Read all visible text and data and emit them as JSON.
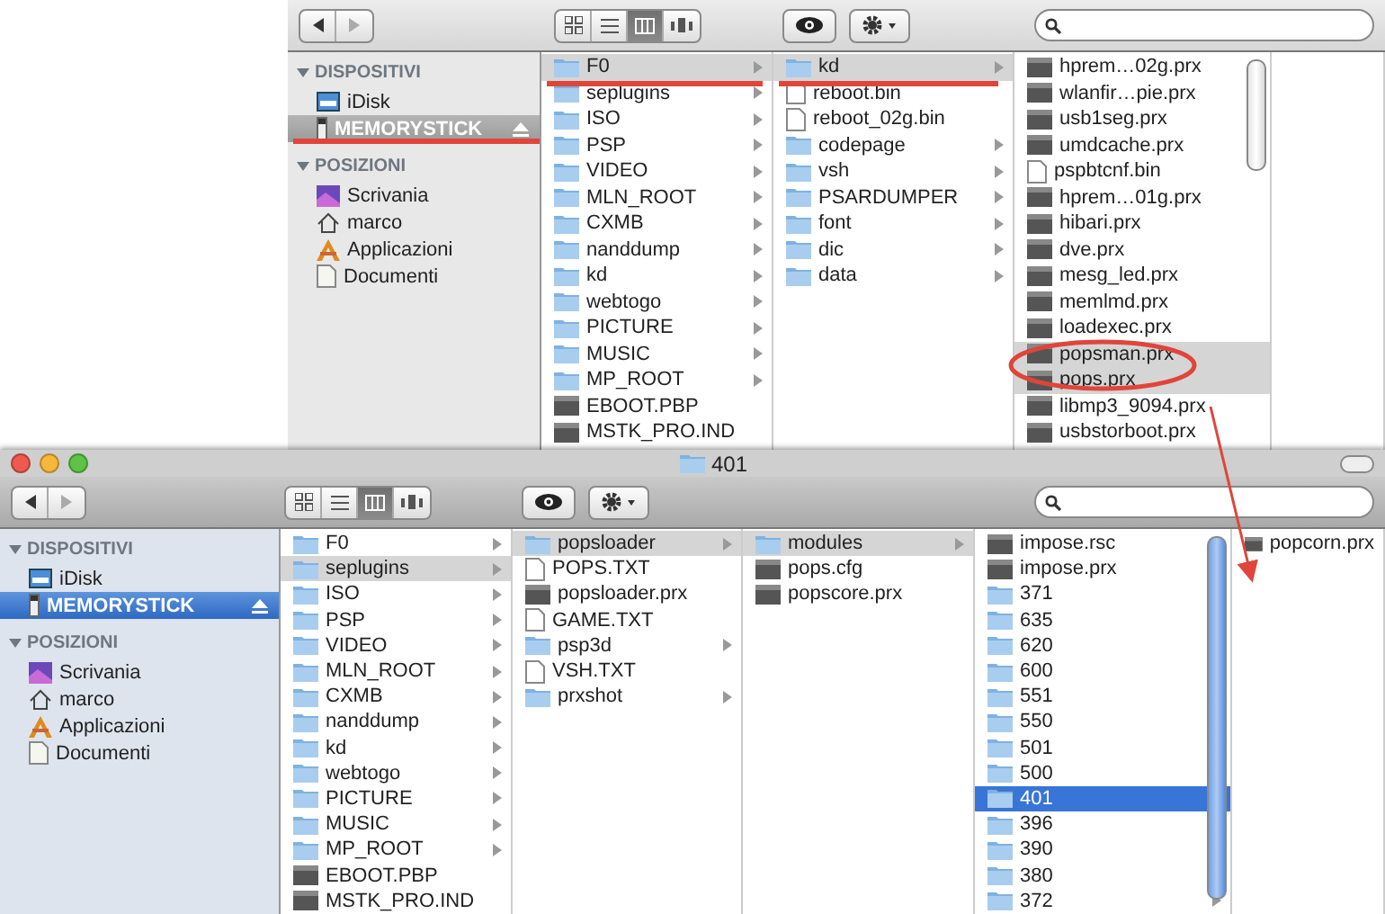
{
  "windows": [
    {
      "active": false,
      "nav": [
        {
          "kind": "back",
          "disabled": false
        },
        {
          "kind": "forward",
          "disabled": true
        }
      ],
      "views": [
        {
          "kind": "icons",
          "selected": false
        },
        {
          "kind": "list",
          "selected": false
        },
        {
          "kind": "columns",
          "selected": true
        },
        {
          "kind": "coverflow",
          "selected": false
        }
      ],
      "sidebar": [
        {
          "title": "DISPOSITIVI",
          "expanded": true,
          "items": [
            {
              "label": "iDisk",
              "kind": "disk",
              "selected": false,
              "eject": false
            },
            {
              "label": "MEMORYSTICK",
              "kind": "drive",
              "selected": true,
              "eject": true
            }
          ]
        },
        {
          "title": "POSIZIONI",
          "expanded": true,
          "items": [
            {
              "label": "Scrivania",
              "kind": "desktop",
              "selected": false,
              "eject": false
            },
            {
              "label": "marco",
              "kind": "home",
              "selected": false,
              "eject": false
            },
            {
              "label": "Applicazioni",
              "kind": "apps",
              "selected": false,
              "eject": false
            },
            {
              "label": "Documenti",
              "kind": "documents",
              "selected": false,
              "eject": false
            }
          ]
        }
      ],
      "columns": [
        {
          "focused": false,
          "items": [
            {
              "name": "F0",
              "kind": "folder",
              "selected": true
            },
            {
              "name": "seplugins",
              "kind": "folder",
              "selected": false
            },
            {
              "name": "ISO",
              "kind": "folder",
              "selected": false
            },
            {
              "name": "PSP",
              "kind": "folder",
              "selected": false
            },
            {
              "name": "VIDEO",
              "kind": "folder",
              "selected": false
            },
            {
              "name": "MLN_ROOT",
              "kind": "folder",
              "selected": false
            },
            {
              "name": "CXMB",
              "kind": "folder",
              "selected": false
            },
            {
              "name": "nanddump",
              "kind": "folder",
              "selected": false
            },
            {
              "name": "kd",
              "kind": "folder",
              "selected": false
            },
            {
              "name": "webtogo",
              "kind": "folder",
              "selected": false
            },
            {
              "name": "PICTURE",
              "kind": "folder",
              "selected": false
            },
            {
              "name": "MUSIC",
              "kind": "folder",
              "selected": false
            },
            {
              "name": "MP_ROOT",
              "kind": "folder",
              "selected": false
            },
            {
              "name": "EBOOT.PBP",
              "kind": "binary",
              "selected": false
            },
            {
              "name": "MSTK_PRO.IND",
              "kind": "binary",
              "selected": false
            }
          ]
        },
        {
          "focused": false,
          "items": [
            {
              "name": "kd",
              "kind": "folder",
              "selected": true
            },
            {
              "name": "reboot.bin",
              "kind": "document",
              "selected": false
            },
            {
              "name": "reboot_02g.bin",
              "kind": "document",
              "selected": false
            },
            {
              "name": "codepage",
              "kind": "folder",
              "selected": false
            },
            {
              "name": "vsh",
              "kind": "folder",
              "selected": false
            },
            {
              "name": "PSARDUMPER",
              "kind": "folder",
              "selected": false
            },
            {
              "name": "font",
              "kind": "folder",
              "selected": false
            },
            {
              "name": "dic",
              "kind": "folder",
              "selected": false
            },
            {
              "name": "data",
              "kind": "folder",
              "selected": false
            }
          ]
        },
        {
          "focused": true,
          "items": [
            {
              "name": "hprem…02g.prx",
              "kind": "binary",
              "selected": false
            },
            {
              "name": "wlanfir…pie.prx",
              "kind": "binary",
              "selected": false
            },
            {
              "name": "usb1seg.prx",
              "kind": "binary",
              "selected": false
            },
            {
              "name": "umdcache.prx",
              "kind": "binary",
              "selected": false
            },
            {
              "name": "pspbtcnf.bin",
              "kind": "document",
              "selected": false
            },
            {
              "name": "hprem…01g.prx",
              "kind": "binary",
              "selected": false
            },
            {
              "name": "hibari.prx",
              "kind": "binary",
              "selected": false
            },
            {
              "name": "dve.prx",
              "kind": "binary",
              "selected": false
            },
            {
              "name": "mesg_led.prx",
              "kind": "binary",
              "selected": false
            },
            {
              "name": "memlmd.prx",
              "kind": "binary",
              "selected": false
            },
            {
              "name": "loadexec.prx",
              "kind": "binary",
              "selected": false
            },
            {
              "name": "popsman.prx",
              "kind": "binary",
              "selected": true
            },
            {
              "name": "pops.prx",
              "kind": "binary",
              "selected": true
            },
            {
              "name": "libmp3_9094.prx",
              "kind": "binary",
              "selected": false
            },
            {
              "name": "usbstorboot.prx",
              "kind": "binary",
              "selected": false
            }
          ]
        }
      ]
    },
    {
      "active": true,
      "title": "401",
      "nav": [
        {
          "kind": "back",
          "disabled": false
        },
        {
          "kind": "forward",
          "disabled": true
        }
      ],
      "views": [
        {
          "kind": "icons",
          "selected": false
        },
        {
          "kind": "list",
          "selected": false
        },
        {
          "kind": "columns",
          "selected": true
        },
        {
          "kind": "coverflow",
          "selected": false
        }
      ],
      "sidebar": [
        {
          "title": "DISPOSITIVI",
          "expanded": true,
          "items": [
            {
              "label": "iDisk",
              "kind": "disk",
              "selected": false,
              "eject": false
            },
            {
              "label": "MEMORYSTICK",
              "kind": "drive",
              "selected": true,
              "eject": true
            }
          ]
        },
        {
          "title": "POSIZIONI",
          "expanded": true,
          "items": [
            {
              "label": "Scrivania",
              "kind": "desktop",
              "selected": false,
              "eject": false
            },
            {
              "label": "marco",
              "kind": "home",
              "selected": false,
              "eject": false
            },
            {
              "label": "Applicazioni",
              "kind": "apps",
              "selected": false,
              "eject": false
            },
            {
              "label": "Documenti",
              "kind": "documents",
              "selected": false,
              "eject": false
            }
          ]
        }
      ],
      "columns": [
        {
          "focused": false,
          "items": [
            {
              "name": "F0",
              "kind": "folder",
              "selected": false
            },
            {
              "name": "seplugins",
              "kind": "folder",
              "selected": true
            },
            {
              "name": "ISO",
              "kind": "folder",
              "selected": false
            },
            {
              "name": "PSP",
              "kind": "folder",
              "selected": false
            },
            {
              "name": "VIDEO",
              "kind": "folder",
              "selected": false
            },
            {
              "name": "MLN_ROOT",
              "kind": "folder",
              "selected": false
            },
            {
              "name": "CXMB",
              "kind": "folder",
              "selected": false
            },
            {
              "name": "nanddump",
              "kind": "folder",
              "selected": false
            },
            {
              "name": "kd",
              "kind": "folder",
              "selected": false
            },
            {
              "name": "webtogo",
              "kind": "folder",
              "selected": false
            },
            {
              "name": "PICTURE",
              "kind": "folder",
              "selected": false
            },
            {
              "name": "MUSIC",
              "kind": "folder",
              "selected": false
            },
            {
              "name": "MP_ROOT",
              "kind": "folder",
              "selected": false
            },
            {
              "name": "EBOOT.PBP",
              "kind": "binary",
              "selected": false
            },
            {
              "name": "MSTK_PRO.IND",
              "kind": "binary",
              "selected": false
            }
          ]
        },
        {
          "focused": false,
          "items": [
            {
              "name": "popsloader",
              "kind": "folder",
              "selected": true
            },
            {
              "name": "POPS.TXT",
              "kind": "document",
              "selected": false
            },
            {
              "name": "popsloader.prx",
              "kind": "binary",
              "selected": false
            },
            {
              "name": "GAME.TXT",
              "kind": "document",
              "selected": false
            },
            {
              "name": "psp3d",
              "kind": "folder",
              "selected": false
            },
            {
              "name": "VSH.TXT",
              "kind": "document",
              "selected": false
            },
            {
              "name": "prxshot",
              "kind": "folder",
              "selected": false
            }
          ]
        },
        {
          "focused": false,
          "items": [
            {
              "name": "modules",
              "kind": "folder",
              "selected": true
            },
            {
              "name": "pops.cfg",
              "kind": "binary",
              "selected": false
            },
            {
              "name": "popscore.prx",
              "kind": "binary",
              "selected": false
            }
          ]
        },
        {
          "focused": true,
          "items": [
            {
              "name": "impose.rsc",
              "kind": "binary",
              "selected": false
            },
            {
              "name": "impose.prx",
              "kind": "binary",
              "selected": false
            },
            {
              "name": "371",
              "kind": "folder",
              "selected": false
            },
            {
              "name": "635",
              "kind": "folder",
              "selected": false
            },
            {
              "name": "620",
              "kind": "folder",
              "selected": false
            },
            {
              "name": "600",
              "kind": "folder",
              "selected": false
            },
            {
              "name": "551",
              "kind": "folder",
              "selected": false
            },
            {
              "name": "550",
              "kind": "folder",
              "selected": false
            },
            {
              "name": "501",
              "kind": "folder",
              "selected": false
            },
            {
              "name": "500",
              "kind": "folder",
              "selected": false
            },
            {
              "name": "401",
              "kind": "folder",
              "selected": true
            },
            {
              "name": "396",
              "kind": "folder",
              "selected": false
            },
            {
              "name": "390",
              "kind": "folder",
              "selected": false
            },
            {
              "name": "380",
              "kind": "folder",
              "selected": false
            },
            {
              "name": "372",
              "kind": "folder",
              "selected": false
            }
          ]
        },
        {
          "focused": false,
          "items": [
            {
              "name": "popcorn.prx",
              "kind": "binary",
              "selected": false
            }
          ]
        }
      ]
    }
  ]
}
